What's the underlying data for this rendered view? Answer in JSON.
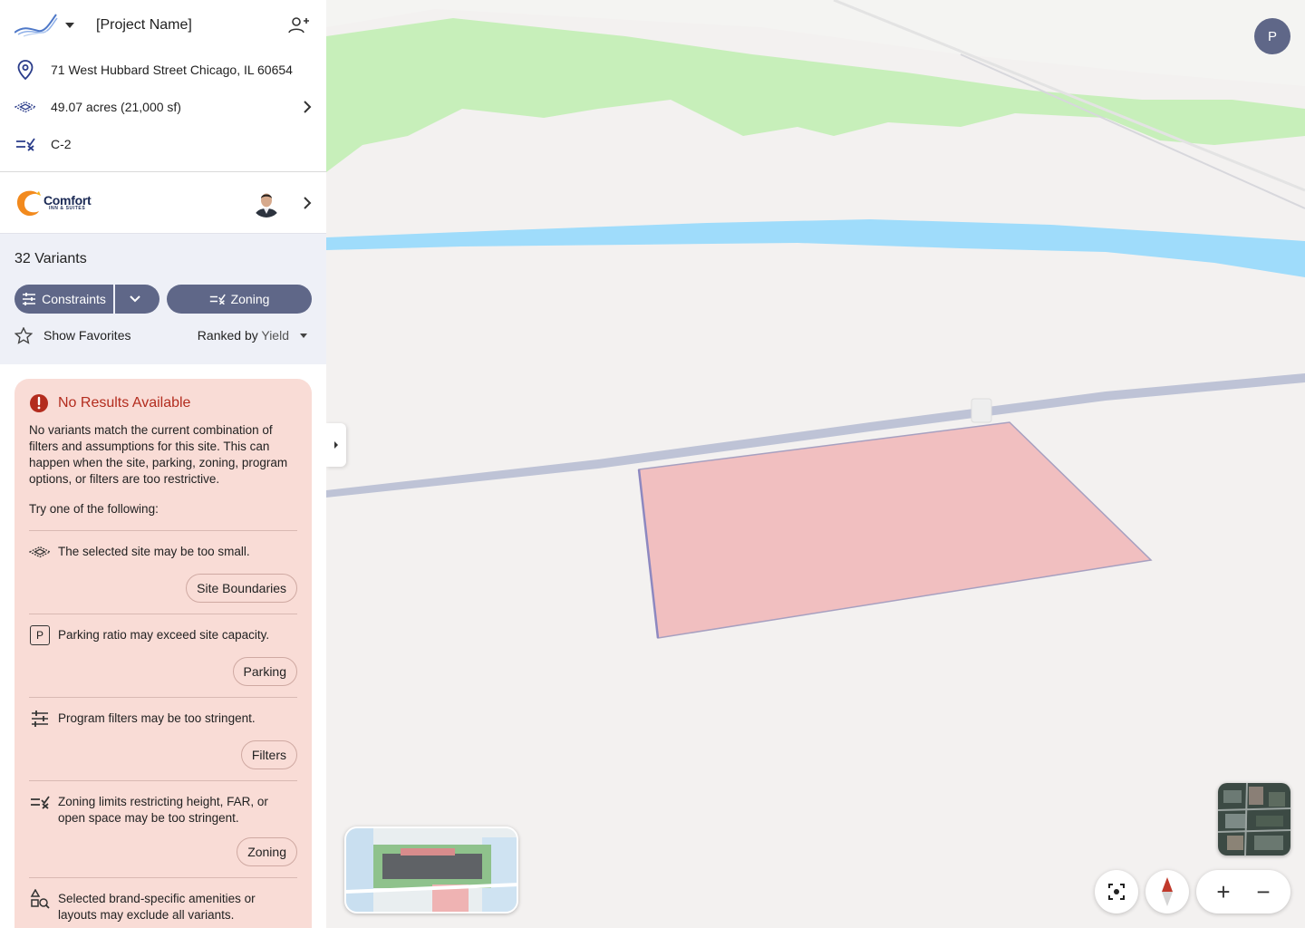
{
  "header": {
    "project_name": "[Project Name]"
  },
  "site": {
    "address": "71 West Hubbard Street Chicago, IL 60654",
    "area": "49.07 acres (21,000 sf)",
    "zoning_code": "C-2"
  },
  "brand": {
    "name": "Comfort",
    "sub": "INN & SUITES"
  },
  "variants": {
    "title": "32 Variants",
    "constraints_label": "Constraints",
    "zoning_label": "Zoning",
    "favorites_label": "Show Favorites",
    "ranked_prefix": "Ranked by ",
    "ranked_value": "Yield"
  },
  "alert": {
    "title": "No Results Available",
    "body": "No variants match the current combination of filters and assumptions for this site. This can happen when the site, parking, zoning, program options, or filters are too restrictive.",
    "try_label": "Try one of the following:",
    "suggestions": [
      {
        "icon": "site-boundary-icon",
        "text": "The selected site may be too small.",
        "button": "Site Boundaries"
      },
      {
        "icon": "parking-icon",
        "text": "Parking ratio may exceed site capacity.",
        "button": "Parking",
        "icon_letter": "P"
      },
      {
        "icon": "sliders-icon",
        "text": "Program filters may be too stringent.",
        "button": "Filters"
      },
      {
        "icon": "zoning-icon",
        "text": "Zoning limits restricting height, FAR, or open space may be too stringent.",
        "button": "Zoning"
      },
      {
        "icon": "amenities-search-icon",
        "text": "Selected brand-specific amenities or layouts may exclude all variants."
      }
    ]
  },
  "map": {
    "user_initial": "P",
    "zoom_in": "+",
    "zoom_out": "−"
  },
  "colors": {
    "accent": "#5f6788",
    "alert_bg": "#f9dcd6",
    "alert_title": "#b32c1e",
    "panel_bg": "#eef0f7",
    "site_fill": "#f2c0c0",
    "river": "#9ddcfb",
    "park": "#c4efb6"
  }
}
